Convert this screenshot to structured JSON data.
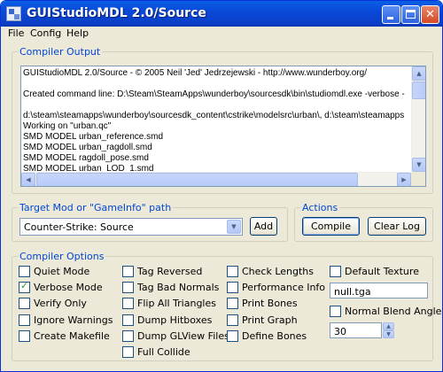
{
  "window": {
    "title": "GUIStudioMDL 2.0/Source"
  },
  "menu": {
    "file": "File",
    "config": "Config",
    "help": "Help"
  },
  "compiler_output": {
    "label": "Compiler Output",
    "lines": [
      "GUIStudioMDL 2.0/Source - © 2005 Neil 'Jed' Jedrzejewski - http://www.wunderboy.org/",
      "",
      "Created command line: D:\\Steam\\SteamApps\\wunderboy\\sourcesdk\\bin\\studiomdl.exe -verbose -",
      "",
      "d:\\steam\\steamapps\\wunderboy\\sourcesdk_content\\cstrike\\modelsrc\\urban\\, d:\\steam\\steamapps",
      "Working on \"urban.qc\"",
      "SMD MODEL urban_reference.smd",
      "SMD MODEL urban_ragdoll.smd",
      "SMD MODEL ragdoll_pose.smd",
      "SMD MODEL urban_LOD_1.smd"
    ]
  },
  "target": {
    "label": "Target Mod or \"GameInfo\" path",
    "selected": "Counter-Strike: Source",
    "add_label": "Add"
  },
  "actions": {
    "label": "Actions",
    "compile_label": "Compile",
    "clear_log_label": "Clear Log"
  },
  "options": {
    "label": "Compiler Options",
    "col1": [
      {
        "label": "Quiet Mode",
        "checked": false
      },
      {
        "label": "Verbose Mode",
        "checked": true
      },
      {
        "label": "Verify Only",
        "checked": false
      },
      {
        "label": "Ignore Warnings",
        "checked": false
      },
      {
        "label": "Create Makefile",
        "checked": false
      }
    ],
    "col2": [
      {
        "label": "Tag Reversed",
        "checked": false
      },
      {
        "label": "Tag Bad Normals",
        "checked": false
      },
      {
        "label": "Flip All Triangles",
        "checked": false
      },
      {
        "label": "Dump Hitboxes",
        "checked": false
      },
      {
        "label": "Dump GLView Files",
        "checked": false
      },
      {
        "label": "Full Collide",
        "checked": false
      }
    ],
    "col3": [
      {
        "label": "Check Lengths",
        "checked": false
      },
      {
        "label": "Performance Info",
        "checked": false
      },
      {
        "label": "Print Bones",
        "checked": false
      },
      {
        "label": "Print Graph",
        "checked": false
      },
      {
        "label": "Define Bones",
        "checked": false
      }
    ],
    "default_texture": {
      "label": "Default Texture",
      "checked": false,
      "value": "null.tga"
    },
    "normal_blend_angle": {
      "label": "Normal Blend Angle",
      "checked": false,
      "value": "30"
    }
  }
}
